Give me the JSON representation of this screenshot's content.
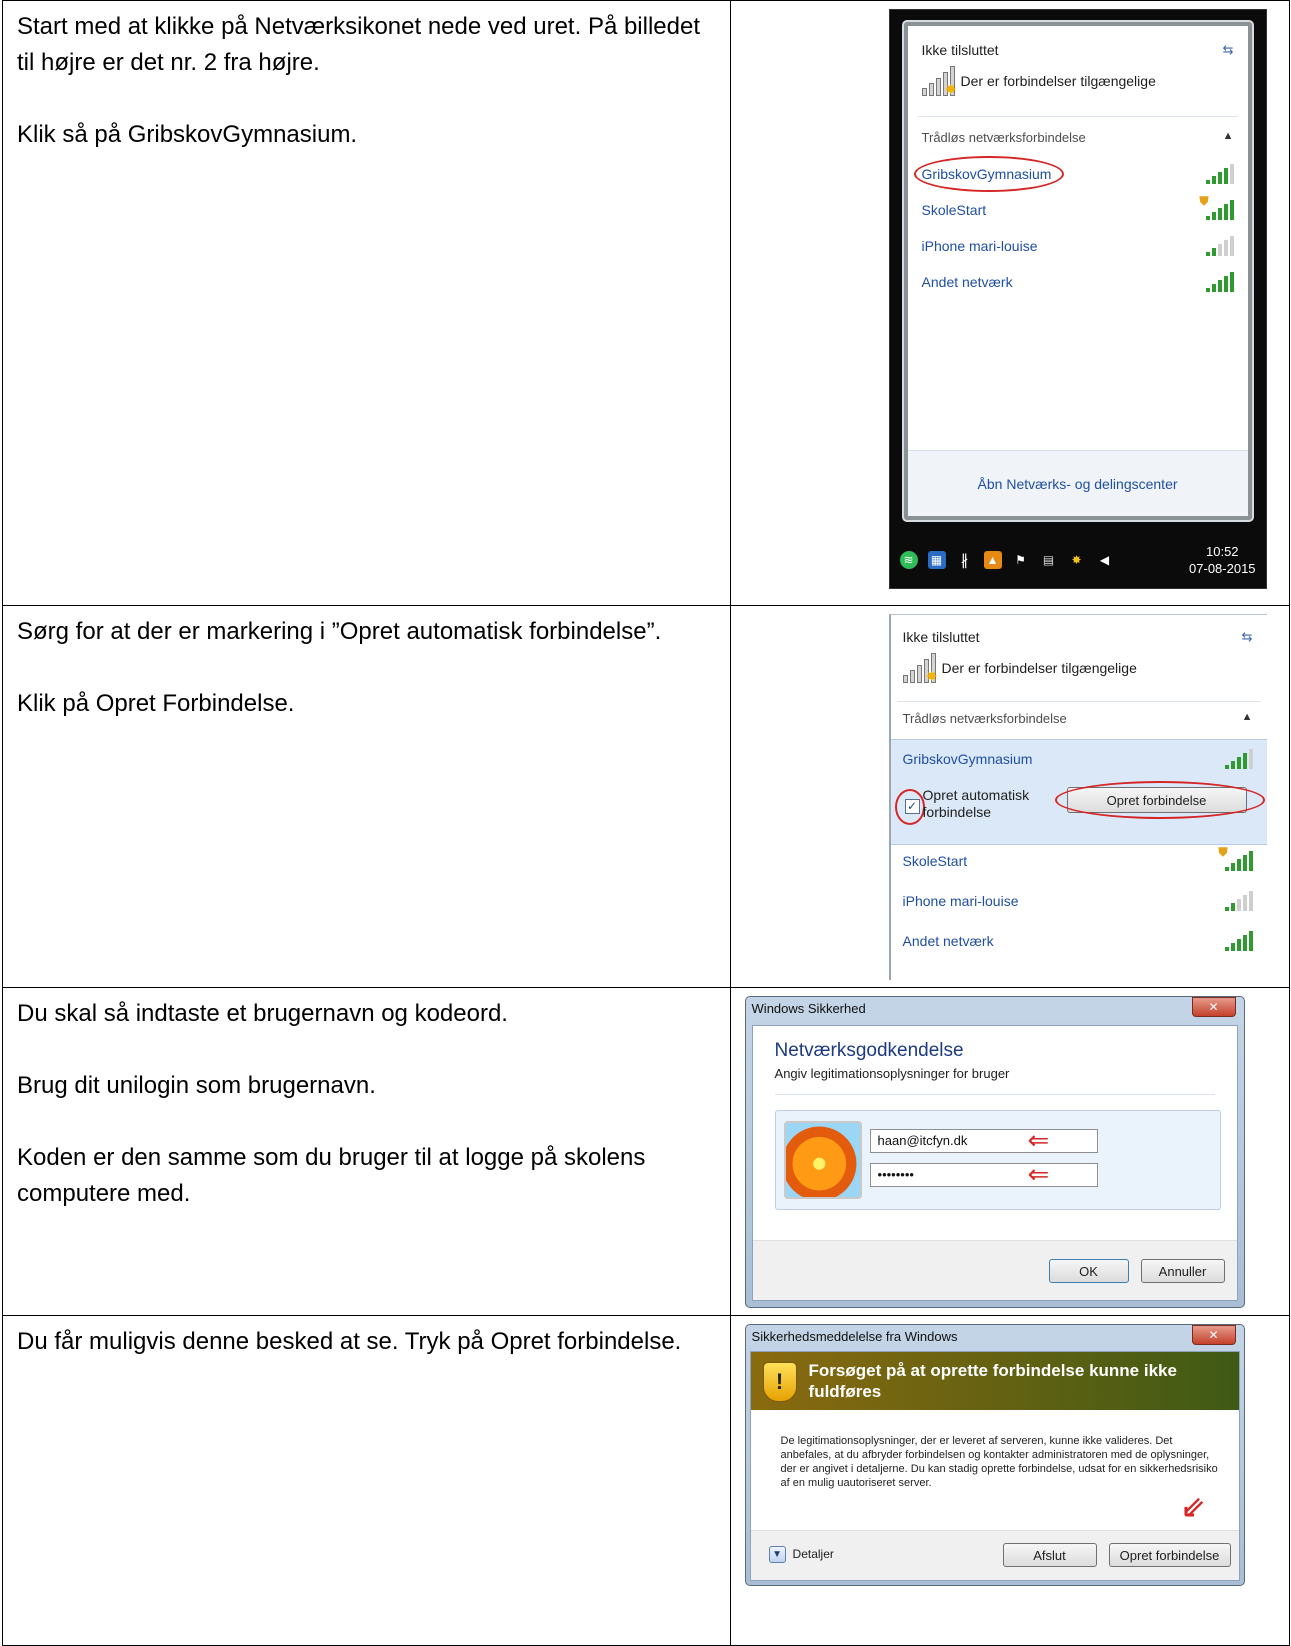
{
  "rows": [
    {
      "paragraphs": [
        "Start med at klikke på Netværksikonet nede ved uret. På billedet til højre er det nr. 2 fra højre.",
        "",
        "Klik så på GribskovGymnasium."
      ]
    },
    {
      "paragraphs": [
        "Sørg for at der er markering i ”Opret automatisk forbindelse”.",
        "",
        "Klik på Opret Forbindelse."
      ]
    },
    {
      "paragraphs": [
        "Du skal så indtaste et brugernavn og kodeord.",
        "",
        "Brug dit unilogin som brugernavn.",
        "",
        "Koden er den samme som du bruger til at logge på skolens computere med."
      ]
    },
    {
      "paragraphs": [
        "Du får muligvis denne besked at se. Tryk på Opret forbindelse."
      ]
    }
  ],
  "network_flyout": {
    "status": "Ikke tilsluttet",
    "available": "Der er forbindelser tilgængelige",
    "section": "Trådløs netværksforbindelse",
    "networks": [
      "GribskovGymnasium",
      "SkoleStart",
      "iPhone mari-louise",
      "Andet netværk"
    ],
    "footer_link": "Åbn Netværks- og delingscenter",
    "clock_time": "10:52",
    "clock_date": "07-08-2015"
  },
  "connect_panel": {
    "auto_connect_label": "Opret automatisk forbindelse",
    "connect_button": "Opret forbindelse"
  },
  "credentials_dialog": {
    "window_title": "Windows Sikkerhed",
    "title": "Netværksgodkendelse",
    "subtitle": "Angiv legitimationsoplysninger for bruger",
    "username": "haan@itcfyn.dk",
    "password_mask": "••••••••",
    "ok_button": "OK",
    "cancel_button": "Annuller"
  },
  "warning_dialog": {
    "window_title": "Sikkerhedsmeddelelse fra Windows",
    "heading": "Forsøget på at oprette forbindelse kunne ikke fuldføres",
    "message": "De legitimationsoplysninger, der er leveret af serveren, kunne ikke valideres. Det anbefales, at du afbryder forbindelsen og kontakter administratoren med de oplysninger, der er angivet i detaljerne. Du kan stadig oprette forbindelse, udsat for en sikkerhedsrisiko af en mulig uautoriseret server.",
    "details_label": "Detaljer",
    "exit_button": "Afslut",
    "connect_button": "Opret forbindelse"
  },
  "colors": {
    "link_blue": "#1f4ea3",
    "highlight_red": "#d62626",
    "signal_green": "#2f9a2f"
  }
}
